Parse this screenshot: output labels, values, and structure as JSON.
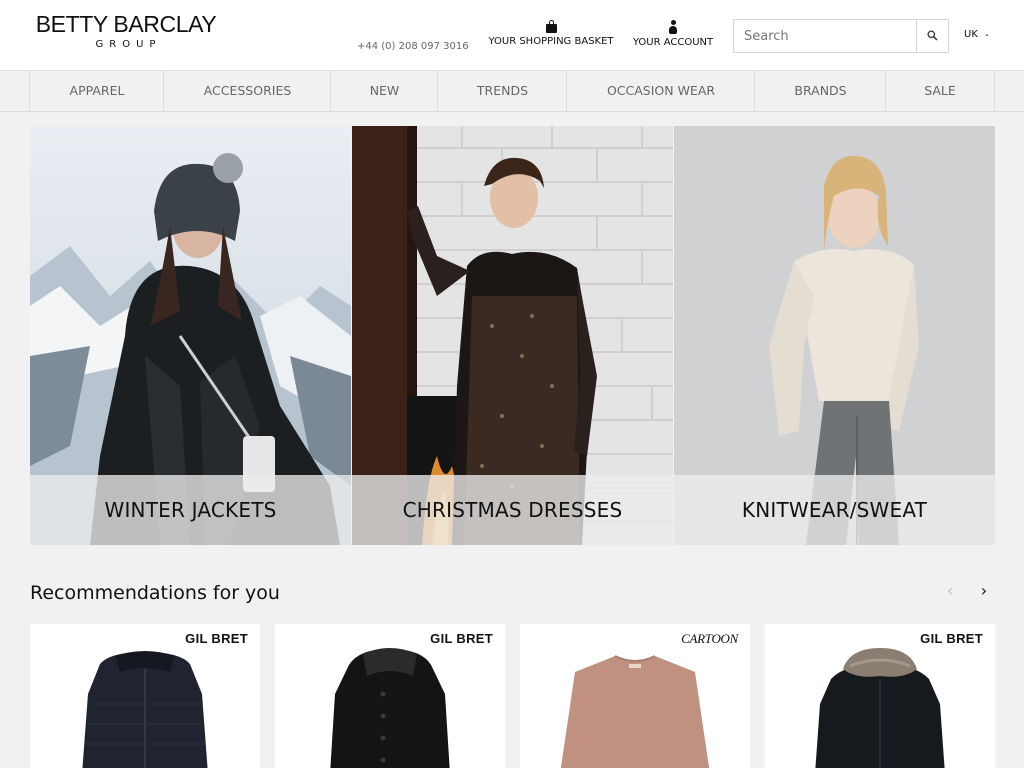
{
  "header": {
    "logo_main": "BETTY BARCLAY",
    "logo_sub": "GROUP",
    "phone": "+44 (0) 208 097 3016",
    "basket_label": "YOUR SHOPPING BASKET",
    "account_label": "YOUR ACCOUNT",
    "search_placeholder": "Search",
    "language": "UK",
    "icons": {
      "basket": "shopping-bag-icon",
      "account": "user-icon",
      "search": "magnifier-icon",
      "language": "chevron-down-icon"
    }
  },
  "nav": {
    "items": [
      {
        "label": "APPAREL"
      },
      {
        "label": "ACCESSORIES"
      },
      {
        "label": "NEW"
      },
      {
        "label": "TRENDS"
      },
      {
        "label": "OCCASION WEAR"
      },
      {
        "label": "BRANDS"
      },
      {
        "label": "SALE"
      }
    ]
  },
  "hero": {
    "tiles": [
      {
        "caption": "WINTER JACKETS"
      },
      {
        "caption": "CHRISTMAS DRESSES"
      },
      {
        "caption": "KNITWEAR/SWEAT"
      }
    ]
  },
  "recommendations": {
    "title": "Recommendations for you",
    "prev_icon": "chevron-left-icon",
    "next_icon": "chevron-right-icon",
    "products": [
      {
        "brand": "GIL BRET",
        "item": "navy quilted jacket"
      },
      {
        "brand": "GIL BRET",
        "item": "black hooded coat"
      },
      {
        "brand": "CARTOON",
        "item": "rose knit sweater"
      },
      {
        "brand": "GIL BRET",
        "item": "black parka with fur hood"
      }
    ]
  },
  "colors": {
    "page_bg": "#f1f1f1",
    "header_bg": "#ffffff",
    "nav_text": "#666666",
    "text": "#111111"
  }
}
